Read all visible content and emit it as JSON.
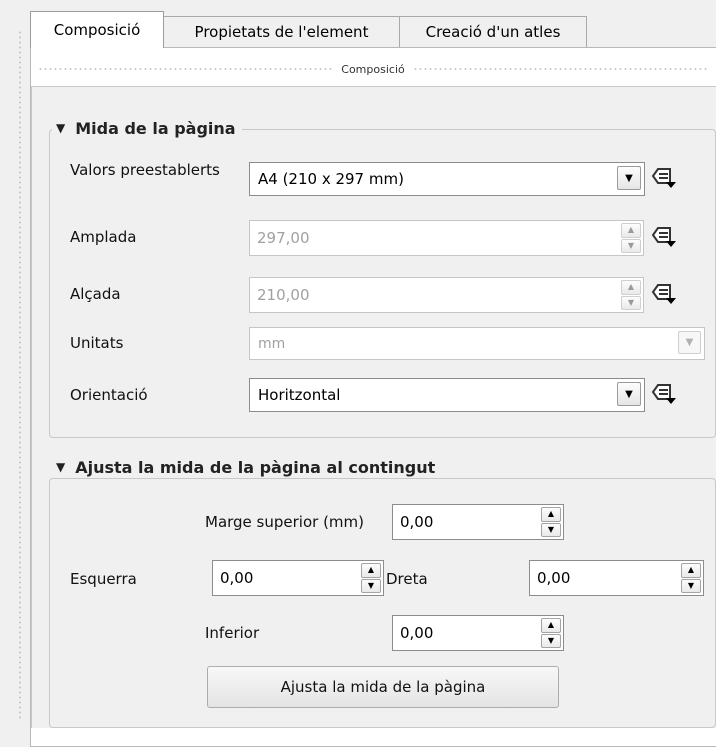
{
  "tabs": [
    {
      "label": "Composició",
      "active": true
    },
    {
      "label": "Propietats de l'element",
      "active": false
    },
    {
      "label": "Creació d'un atles",
      "active": false
    }
  ],
  "panel_title": "Composició",
  "page_size": {
    "title": "Mida de la pàgina",
    "presets_label": "Valors preestablerts",
    "presets_value": "A4 (210 x 297 mm)",
    "width_label": "Amplada",
    "width_value": "297,00",
    "height_label": "Alçada",
    "height_value": "210,00",
    "units_label": "Unitats",
    "units_value": "mm",
    "orientation_label": "Orientació",
    "orientation_value": "Horitzontal"
  },
  "fit_page": {
    "title": "Ajusta la mida de la pàgina al contingut",
    "top_margin_label": "Marge superior (mm)",
    "top_margin_value": "0,00",
    "left_label": "Esquerra",
    "left_value": "0,00",
    "right_label": "Dreta",
    "right_value": "0,00",
    "bottom_label": "Inferior",
    "bottom_value": "0,00",
    "button_label": "Ajusta la mida de la pàgina"
  },
  "icons": {
    "expand_triangle": "triangle-down-icon",
    "data_defined": "data-defined-override-icon",
    "combo_arrow": "chevron-down-icon",
    "spin_up": "arrow-up-icon",
    "spin_down": "arrow-down-icon"
  }
}
